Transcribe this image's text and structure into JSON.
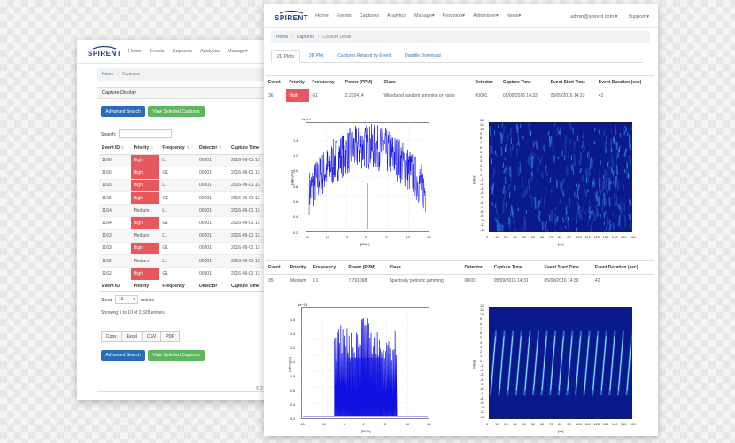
{
  "brand": "SPIRENT",
  "back_window": {
    "nav": [
      "Home",
      "Events",
      "Captures",
      "Analytics",
      "Manage▾"
    ],
    "breadcrumb": [
      "Home",
      "Captures"
    ],
    "panel_title": "Capture Display",
    "buttons": {
      "advanced_search": "Advanced Search",
      "view_selected": "View Selected Captures"
    },
    "search_label": "Search:",
    "columns": [
      "Event ID",
      "Priority",
      "Frequency",
      "Detector",
      "Capture Time"
    ],
    "rows": [
      [
        "1166",
        "High",
        "L1",
        "00001",
        "2016-09-01 13"
      ],
      [
        "1166",
        "High",
        "G1",
        "00001",
        "2016-09-01 13"
      ],
      [
        "1165",
        "High",
        "L1",
        "00001",
        "2016-09-01 13"
      ],
      [
        "1165",
        "High",
        "G1",
        "00001",
        "2016-09-01 13"
      ],
      [
        "1164",
        "Medium",
        "L1",
        "00001",
        "2016-09-01 13"
      ],
      [
        "1164",
        "High",
        "G1",
        "00001",
        "2016-09-01 13"
      ],
      [
        "1163",
        "Medium",
        "L1",
        "00001",
        "2016-09-01 13"
      ],
      [
        "1163",
        "High",
        "G1",
        "00001",
        "2016-09-01 13"
      ],
      [
        "1162",
        "Medium",
        "L1",
        "00001",
        "2016-09-01 13"
      ],
      [
        "1162",
        "High",
        "G1",
        "00001",
        "2016-09-01 13"
      ]
    ],
    "footer_columns": [
      "Event ID",
      "Priority",
      "Frequency",
      "Detector",
      "Capture Time"
    ],
    "show_label": "Show",
    "show_value": "10",
    "entries_label": "entries",
    "info": "Showing 1 to 10 of 2,328 entries",
    "export": [
      "Copy",
      "Excel",
      "CSV",
      "PDF"
    ],
    "footer_text": "© 2"
  },
  "front_window": {
    "nav": [
      "Home",
      "Events",
      "Captures",
      "Analytics",
      "Manage▾",
      "Provision▾",
      "Administer▾",
      "News▾"
    ],
    "user": "admin@spirent.com ▾",
    "support": "Support ▾",
    "breadcrumb": [
      "Home",
      "Captures",
      "Capture Detail"
    ],
    "tabs": [
      "2D Plots",
      "3D Plot",
      "Captures Related by Event",
      "Datafile Download"
    ],
    "columns": [
      "Event",
      "Priority",
      "Frequency",
      "Power (PPM)",
      "Class",
      "Detector",
      "Capture Time",
      "Event Start Time",
      "Event Duration (sec)"
    ],
    "event1": [
      "36",
      "High",
      "G1",
      "2.202414",
      "Wideband random jamming or noise",
      "00001",
      "05/09/2016 14:33",
      "05/09/2016 14:33",
      "42"
    ],
    "event2": [
      "35",
      "Medium",
      "L1",
      "7.791098",
      "Spectrally periodic jamming",
      "00001",
      "05/09/2016 14:31",
      "05/09/2016 14:30",
      "42"
    ],
    "plot1": {
      "scale": "1e−14",
      "yticks": [
        "1.4",
        "1.2",
        "1.0",
        "0.8",
        "0.6",
        "0.4",
        "0.2"
      ],
      "xticks": [
        "−15",
        "−10",
        "−5",
        "0",
        "5",
        "10",
        "15"
      ],
      "ylabel": "[dBm/Hz]",
      "xlabel": "[MHz]"
    },
    "plot2": {
      "yticks": [
        "12",
        "11",
        "10",
        "9",
        "8",
        "7",
        "6",
        "5",
        "4",
        "3",
        "2",
        "1",
        "0",
        "-1",
        "-2",
        "-3",
        "-4",
        "-5",
        "-6",
        "-7",
        "-8",
        "-9",
        "-10",
        "-11",
        "-12"
      ],
      "xticks": [
        "0",
        "10",
        "20",
        "30",
        "40",
        "50",
        "60",
        "70",
        "80",
        "90",
        "100",
        "110",
        "120",
        "130",
        "140",
        "150",
        "160"
      ],
      "ylabel": "[MHz]",
      "xlabel": "[us]"
    },
    "plot3": {
      "scale": "1e−13",
      "yticks": [
        "1.6",
        "1.4",
        "1.2",
        "1.0",
        "0.8",
        "0.6",
        "0.4",
        "0.2"
      ],
      "xticks": [
        "−15",
        "−10",
        "−5",
        "0",
        "5",
        "10",
        "15"
      ],
      "ylabel": "[dBm/Hz]",
      "xlabel": "[MHz]"
    },
    "plot4": {
      "yticks": [
        "12",
        "11",
        "10",
        "9",
        "8",
        "7",
        "6",
        "5",
        "4",
        "3",
        "2",
        "1",
        "0",
        "-1",
        "-2",
        "-3",
        "-4",
        "-5",
        "-6",
        "-7",
        "-8",
        "-9",
        "-10",
        "-11",
        "-12"
      ],
      "xticks": [
        "0",
        "10",
        "20",
        "30",
        "40",
        "50",
        "60",
        "70",
        "80",
        "90",
        "100",
        "110",
        "120",
        "130",
        "140",
        "150",
        "160"
      ],
      "ylabel": "[MHz]",
      "xlabel": "[us]"
    }
  },
  "colors": {
    "high": "#e8575b",
    "link": "#337ab7",
    "primary": "#2b6cb8",
    "success": "#5cb85c",
    "trace": "#1010e0",
    "spectro_bg": "#0a1a8c"
  }
}
